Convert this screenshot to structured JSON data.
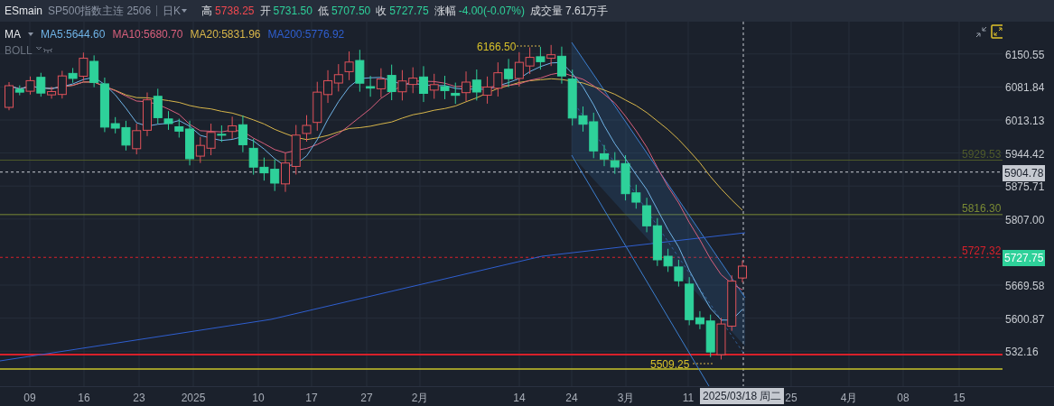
{
  "header": {
    "symbol": "ESmain",
    "name": "SP500指数主连 2506",
    "period": "日K",
    "quotes": [
      {
        "label": "高",
        "value": "5738.25",
        "color": "#f0484f"
      },
      {
        "label": "开",
        "value": "5731.50",
        "color": "#2ed19a"
      },
      {
        "label": "低",
        "value": "5707.50",
        "color": "#2ed19a"
      },
      {
        "label": "收",
        "value": "5727.75",
        "color": "#2ed19a"
      },
      {
        "label": "涨幅",
        "value": "-4.00(-0.07%)",
        "color": "#2ed19a"
      },
      {
        "label": "成交量",
        "value": "7.61万手",
        "color": "#d6d9de"
      }
    ]
  },
  "indicators": {
    "main": "MA",
    "lines": [
      {
        "label": "MA5:5644.60",
        "color": "#6fb3e6"
      },
      {
        "label": "MA10:5680.70",
        "color": "#d9607d"
      },
      {
        "label": "MA20:5831.96",
        "color": "#d8b64a"
      },
      {
        "label": "MA200:5776.92",
        "color": "#2f5fd0"
      }
    ],
    "secondary": "BOLL"
  },
  "annotations": {
    "high": "6166.50",
    "low": "5509.25"
  },
  "levels": [
    {
      "value": "5929.53",
      "color": "#4f5a2a"
    },
    {
      "value": "5816.30",
      "color": "#7a8a34"
    },
    {
      "value": "5727.32",
      "color": "#d8202a"
    }
  ],
  "price_axis": [
    "6150.55",
    "6081.84",
    "6013.13",
    "5944.42",
    "5875.71",
    "5807.00",
    "5669.58",
    "5600.87",
    "532.16"
  ],
  "crosshair_price": "5904.78",
  "current_price": "5727.75",
  "date_axis": [
    "09",
    "16",
    "23",
    "2025",
    "10",
    "17",
    "27",
    "2月",
    "14",
    "24",
    "3月",
    "11",
    "25",
    "4月",
    "08",
    "15"
  ],
  "crosshair_date": "2025/03/18 周二"
}
